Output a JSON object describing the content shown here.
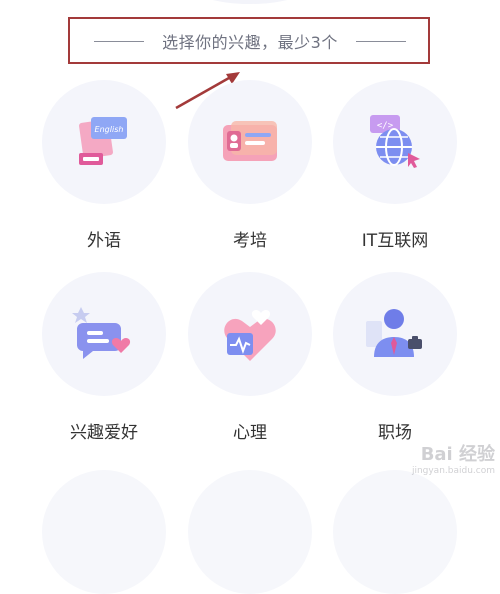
{
  "header": {
    "title": "选择你的兴趣，最少3个"
  },
  "interests": [
    {
      "label": "外语",
      "icon": "language-cards-icon"
    },
    {
      "label": "考培",
      "icon": "id-card-icon"
    },
    {
      "label": "IT互联网",
      "icon": "code-globe-icon"
    },
    {
      "label": "兴趣爱好",
      "icon": "chat-heart-icon"
    },
    {
      "label": "心理",
      "icon": "heart-pulse-icon"
    },
    {
      "label": "职场",
      "icon": "businessman-icon"
    }
  ],
  "annotation": {
    "color": "#a33a3a"
  },
  "watermark": {
    "text": "Bai 经验",
    "subtext": "jingyan.baidu.com"
  }
}
